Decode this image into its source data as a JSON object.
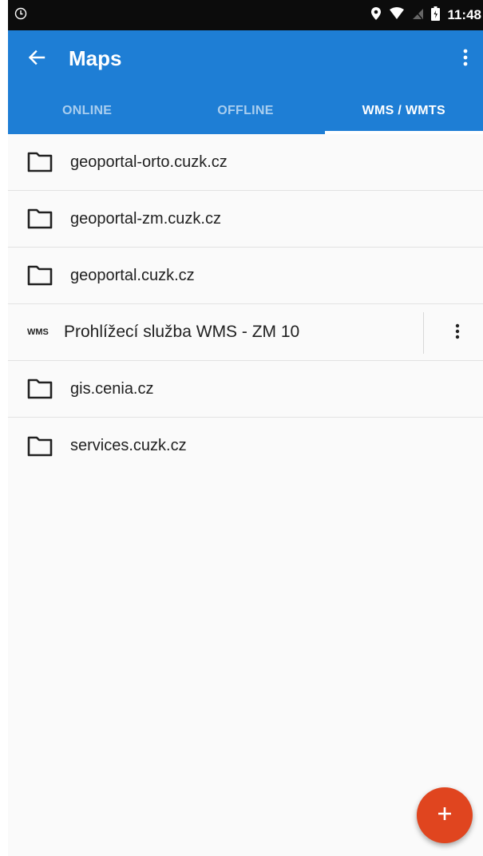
{
  "status_bar": {
    "time": "11:48",
    "icons": [
      "clock-icon",
      "location-icon",
      "wifi-icon",
      "no-signal-icon",
      "battery-icon"
    ]
  },
  "app_bar": {
    "title": "Maps",
    "back_icon": "arrow-back-icon",
    "menu_icon": "more-vert-icon",
    "color": "#1e7ed5"
  },
  "tabs": [
    {
      "label": "ONLINE",
      "active": false
    },
    {
      "label": "OFFLINE",
      "active": false
    },
    {
      "label": "WMS / WMTS",
      "active": true
    }
  ],
  "list": {
    "items": [
      {
        "type": "folder",
        "label": "geoportal-orto.cuzk.cz"
      },
      {
        "type": "folder",
        "label": "geoportal-zm.cuzk.cz"
      },
      {
        "type": "folder",
        "label": "geoportal.cuzk.cz"
      },
      {
        "type": "wms",
        "badge": "WMS",
        "label": "Prohlížecí služba WMS - ZM 10"
      },
      {
        "type": "folder",
        "label": "gis.cenia.cz"
      },
      {
        "type": "folder",
        "label": "services.cuzk.cz"
      }
    ]
  },
  "fab": {
    "icon": "plus-icon",
    "color": "#e0451f"
  }
}
